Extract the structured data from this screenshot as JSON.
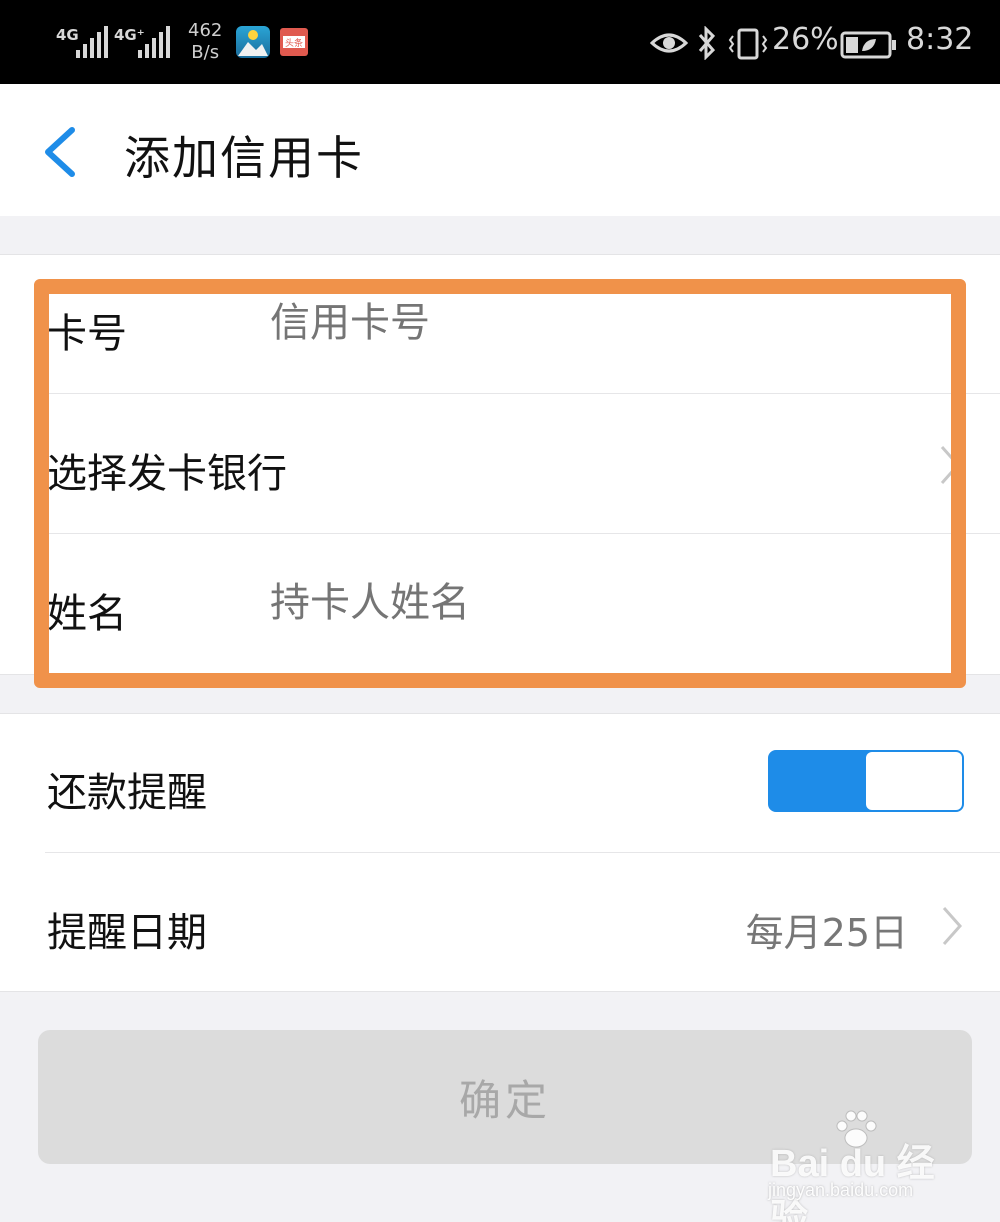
{
  "status_bar": {
    "network1": "4G",
    "network2": "4G⁺",
    "speed_value": "462",
    "speed_unit": "B/s",
    "battery_percent": "26%",
    "time": "8:32",
    "icons": [
      "signal-icon",
      "eye-icon",
      "bluetooth-icon",
      "vibrate-icon",
      "battery-icon"
    ],
    "app_icon_label": "头条"
  },
  "header": {
    "title": "添加信用卡"
  },
  "card_form": {
    "card_number_label": "卡号",
    "card_number_placeholder": "信用卡号",
    "bank_label": "选择发卡银行",
    "name_label": "姓名",
    "name_placeholder": "持卡人姓名"
  },
  "reminder": {
    "toggle_label": "还款提醒",
    "toggle_on": true,
    "date_label": "提醒日期",
    "date_value": "每月25日"
  },
  "confirm_button": "确定",
  "watermark": {
    "main": "Bai du 经验",
    "sub": "jingyan.baidu.com"
  },
  "colors": {
    "accent": "#1e8ce8",
    "highlight": "#f0924a",
    "placeholder": "#c4c4c4",
    "disabled_button": "#dcdcdc"
  }
}
